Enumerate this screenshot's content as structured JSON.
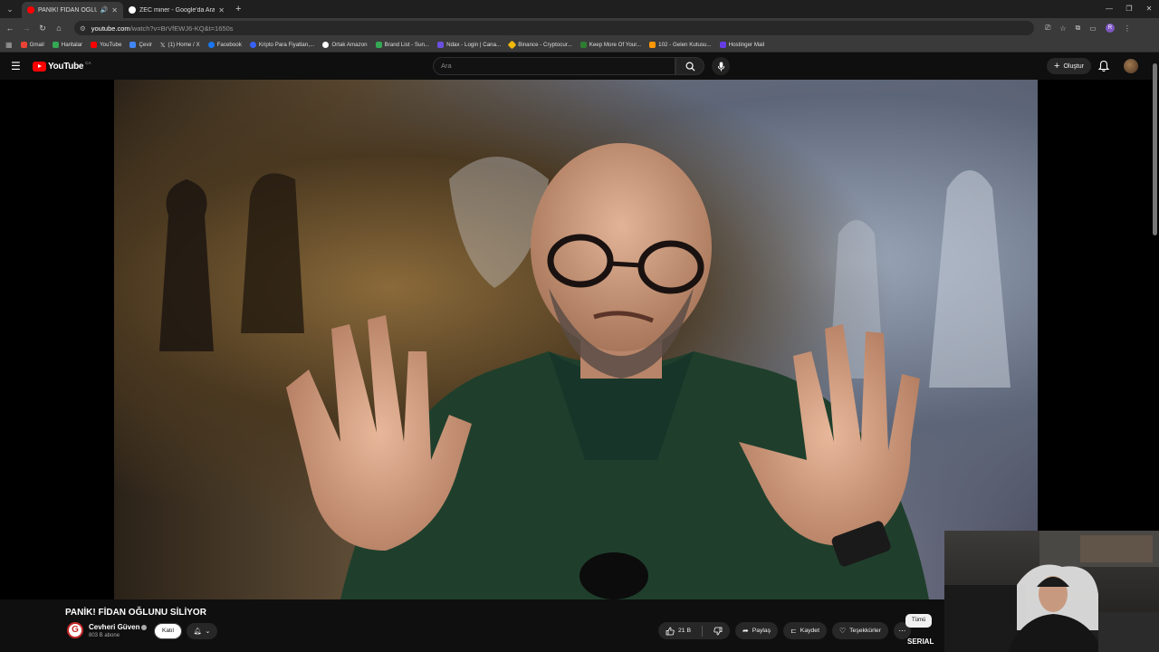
{
  "browser": {
    "tabs": [
      {
        "title": "PANİK! FİDAN OĞLUNU Sİ...",
        "active": true,
        "favicon_color": "#ff0000"
      },
      {
        "title": "ZEC miner - Google'da Ara",
        "active": false,
        "favicon_color": "#ffffff"
      }
    ],
    "address": {
      "host": "youtube.com",
      "path": "/watch?v=BrVfEWJ6-KQ&t=1650s"
    },
    "profile_initial": "R",
    "bookmarks": [
      {
        "label": "Gmail",
        "color": "#ea4335"
      },
      {
        "label": "Haritalar",
        "color": "#34a853"
      },
      {
        "label": "YouTube",
        "color": "#ff0000"
      },
      {
        "label": "Çevir",
        "color": "#4285f4"
      },
      {
        "label": "(1) Home / X",
        "color": "#000000"
      },
      {
        "label": "Facebook",
        "color": "#1877f2"
      },
      {
        "label": "Kripto Para Fiyatları,...",
        "color": "#3861fb"
      },
      {
        "label": "Ortak Amazon",
        "color": "#ffffff"
      },
      {
        "label": "Brand List - Sun...",
        "color": "#34a853"
      },
      {
        "label": "Ndax - Login | Cana...",
        "color": "#6c4fe0"
      },
      {
        "label": "Binance - Cryptocur...",
        "color": "#f0b90b"
      },
      {
        "label": "Keep More Of Your...",
        "color": "#2e7d32"
      },
      {
        "label": "102 - Gelen Kutusu...",
        "color": "#ff9800"
      },
      {
        "label": "Hostinger Mail",
        "color": "#673de6"
      }
    ]
  },
  "youtube": {
    "logo_text": "YouTube",
    "country_code": "CA",
    "search_placeholder": "Ara",
    "create_label": "Oluştur"
  },
  "video": {
    "title": "PANİK! FİDAN OĞLUNU SİLİYOR",
    "channel_name": "Cevheri Güven",
    "channel_initial": "G",
    "subscribers": "803 B abone",
    "join_label": "Katıl",
    "likes": "21 B",
    "share_label": "Paylaş",
    "save_label": "Kaydet",
    "thanks_label": "Teşekkürler"
  },
  "sidebar": {
    "chip_all": "Tümü",
    "next_item": "SERIAL"
  },
  "colors": {
    "yt_red": "#ff0000",
    "background": "#0f0f0f",
    "pill": "#272727"
  }
}
